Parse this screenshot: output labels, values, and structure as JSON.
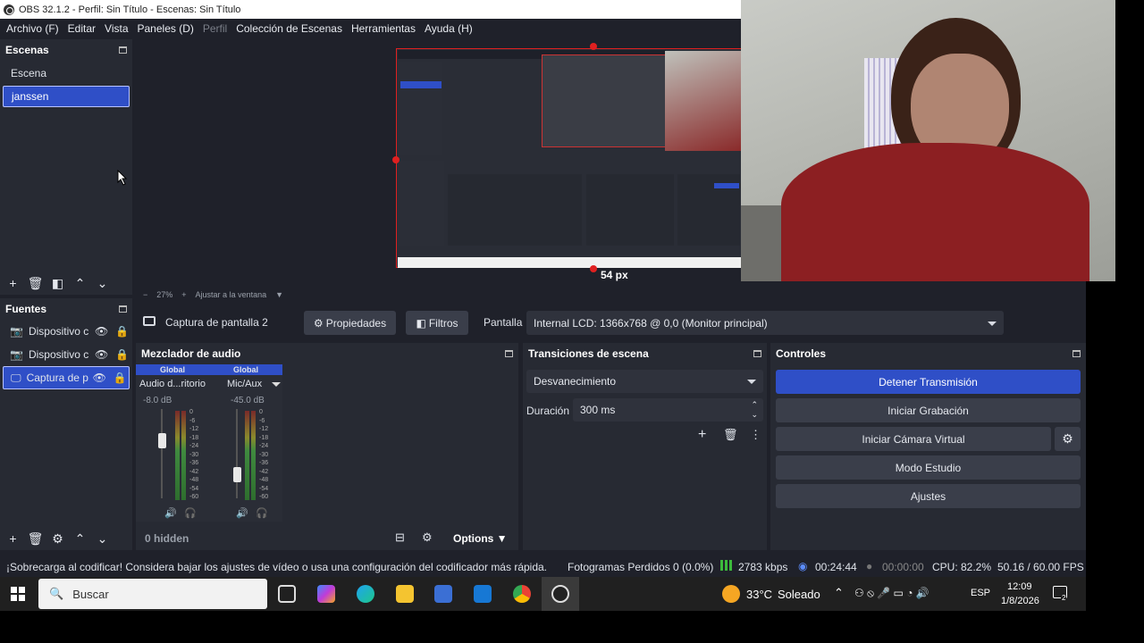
{
  "window": {
    "title": "OBS 32.1.2 - Perfil: Sin Título - Escenas: Sin Título"
  },
  "menu": [
    "Archivo (F)",
    "Editar",
    "Vista",
    "Paneles (D)",
    "Perfil",
    "Colección de Escenas",
    "Herramientas",
    "Ayuda (H)"
  ],
  "scenes": {
    "title": "Escenas",
    "items": [
      "Escena",
      "janssen"
    ]
  },
  "preview": {
    "zoom": "27%",
    "fit_label": "Ajustar a la ventana",
    "px_label": "54 px"
  },
  "sources": {
    "title": "Fuentes",
    "items": [
      "Dispositivo c",
      "Dispositivo c",
      "Captura de p"
    ]
  },
  "source_bar": {
    "name": "Captura de pantalla 2",
    "properties": "Propiedades",
    "filters": "Filtros",
    "display_label": "Pantalla",
    "display_value": "Internal LCD: 1366x768 @ 0,0 (Monitor principal)"
  },
  "mixer": {
    "title": "Mezclador de audio",
    "channels": [
      {
        "badge": "Global",
        "name": "Audio d...ritorio",
        "db": "-8.0 dB",
        "level": 0.62
      },
      {
        "badge": "Global",
        "name": "Mic/Aux",
        "db": "-45.0 dB",
        "level": 0.25
      }
    ],
    "scale": [
      "0",
      "-6",
      "-12",
      "-18",
      "-24",
      "-30",
      "-36",
      "-42",
      "-48",
      "-54",
      "-60"
    ],
    "hidden": "0 hidden",
    "options": "Options"
  },
  "transitions": {
    "title": "Transiciones de escena",
    "selected": "Desvanecimiento",
    "duration_label": "Duración",
    "duration_value": "300 ms"
  },
  "controls": {
    "title": "Controles",
    "stop_stream": "Detener Transmisión",
    "start_record": "Iniciar Grabación",
    "virtual_cam": "Iniciar Cámara Virtual",
    "studio": "Modo Estudio",
    "settings": "Ajustes"
  },
  "status": {
    "warning": "¡Sobrecarga al codificar! Considera bajar los ajustes de vídeo o usa una configuración del codificador más rápida.",
    "dropped": "Fotogramas Perdidos 0 (0.0%)",
    "bitrate": "2783 kbps",
    "stream_time": "00:24:44",
    "rec_time": "00:00:00",
    "cpu": "CPU: 82.2%",
    "fps": "50.16 / 60.00 FPS"
  },
  "taskbar": {
    "search": "Buscar",
    "weather_temp": "33°C",
    "weather_text": "Soleado",
    "lang": "ESP",
    "time": "12:09",
    "date": "1/8/2026",
    "notif_count": "2"
  }
}
